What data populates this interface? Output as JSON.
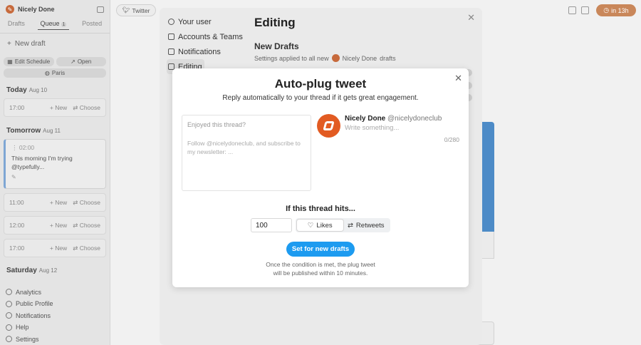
{
  "sidebar": {
    "title": "Nicely Done",
    "tabs": [
      {
        "label": "Drafts"
      },
      {
        "label": "Queue",
        "count": "1"
      },
      {
        "label": "Posted"
      }
    ],
    "new_draft": "New draft",
    "edit_schedule": "Edit Schedule",
    "open": "Open",
    "timezone": "Paris",
    "days": [
      {
        "name": "Today",
        "date": "Aug 10"
      },
      {
        "name": "Tomorrow",
        "date": "Aug 11"
      },
      {
        "name": "Saturday",
        "date": "Aug 12"
      }
    ],
    "slot_new": "New",
    "slot_choose": "Choose",
    "slots": [
      "17:00",
      "11:00",
      "12:00",
      "17:00"
    ],
    "draft": {
      "time": "02:00",
      "text": "This morning I'm trying @typefully..."
    },
    "footer": [
      {
        "label": "Analytics"
      },
      {
        "label": "Public Profile"
      },
      {
        "label": "Notifications"
      },
      {
        "label": "Help"
      },
      {
        "label": "Settings"
      }
    ]
  },
  "topbar": {
    "twitter": "Twitter",
    "timer": "in 13h"
  },
  "settings": {
    "nav": [
      {
        "label": "Your user",
        "icon": "user-circle-icon"
      },
      {
        "label": "Accounts & Teams",
        "icon": "users-icon"
      },
      {
        "label": "Notifications",
        "icon": "notification-icon"
      },
      {
        "label": "Editing",
        "icon": "pencil-icon"
      }
    ],
    "title": "Editing",
    "section_title": "New Drafts",
    "section_desc_prefix": "Settings applied to all new",
    "account_name": "Nicely Done",
    "section_desc_suffix": "drafts"
  },
  "modal": {
    "title": "Auto-plug tweet",
    "subtitle": "Reply automatically to your thread if it gets great engagement.",
    "placeholder_top": "Enjoyed this thread?",
    "placeholder_body": "Follow @nicelydoneclub, and subscribe to my newsletter: ...",
    "author_name": "Nicely Done",
    "author_handle": "@nicelydoneclub",
    "write_placeholder": "Write something...",
    "counter": "0/280",
    "hits_title": "If this thread hits...",
    "threshold_value": "100",
    "metric_options": [
      {
        "label": "Likes",
        "icon": "heart-icon",
        "selected": true
      },
      {
        "label": "Retweets",
        "icon": "retweet-icon",
        "selected": false
      }
    ],
    "primary_button": "Set for new drafts",
    "note": "Once the condition is met, the plug tweet will be published within 10 minutes."
  },
  "colors": {
    "accent": "#1d9bf0",
    "brand": "#e25b22",
    "timer": "#c9875a"
  }
}
